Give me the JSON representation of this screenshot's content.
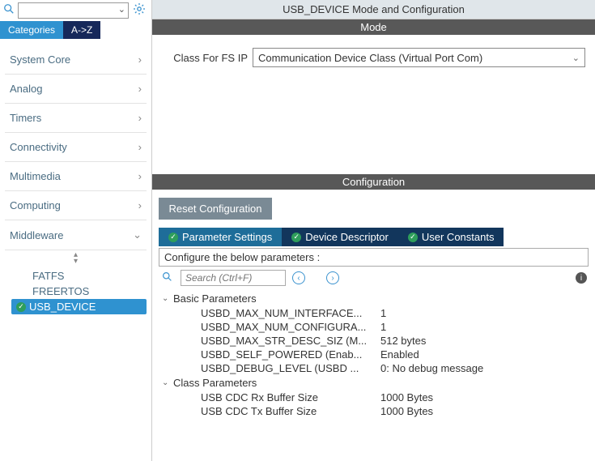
{
  "left": {
    "tabs": {
      "categories": "Categories",
      "az": "A->Z"
    },
    "sections": [
      {
        "label": "System Core",
        "expanded": false
      },
      {
        "label": "Analog",
        "expanded": false
      },
      {
        "label": "Timers",
        "expanded": false
      },
      {
        "label": "Connectivity",
        "expanded": false
      },
      {
        "label": "Multimedia",
        "expanded": false
      },
      {
        "label": "Computing",
        "expanded": false
      },
      {
        "label": "Middleware",
        "expanded": true
      }
    ],
    "middleware_items": [
      {
        "label": "FATFS",
        "selected": false
      },
      {
        "label": "FREERTOS",
        "selected": false
      },
      {
        "label": "USB_DEVICE",
        "selected": true
      }
    ]
  },
  "right": {
    "title": "USB_DEVICE Mode and Configuration",
    "mode_header": "Mode",
    "mode_label": "Class For FS IP",
    "mode_value": "Communication Device Class (Virtual Port Com)",
    "config_header": "Configuration",
    "reset_label": "Reset Configuration",
    "tabs": {
      "param": "Parameter Settings",
      "device": "Device Descriptor",
      "user": "User Constants"
    },
    "instruction": "Configure the below parameters :",
    "search_placeholder": "Search (Ctrl+F)",
    "groups": [
      {
        "name": "Basic Parameters",
        "rows": [
          {
            "name": "USBD_MAX_NUM_INTERFACE...",
            "value": "1"
          },
          {
            "name": "USBD_MAX_NUM_CONFIGURA...",
            "value": "1"
          },
          {
            "name": "USBD_MAX_STR_DESC_SIZ (M...",
            "value": "512 bytes"
          },
          {
            "name": "USBD_SELF_POWERED (Enab...",
            "value": "Enabled"
          },
          {
            "name": "USBD_DEBUG_LEVEL (USBD ...",
            "value": "0: No debug message"
          }
        ]
      },
      {
        "name": "Class Parameters",
        "rows": [
          {
            "name": "USB CDC Rx Buffer Size",
            "value": "1000 Bytes"
          },
          {
            "name": "USB CDC Tx Buffer Size",
            "value": "1000 Bytes"
          }
        ]
      }
    ]
  }
}
